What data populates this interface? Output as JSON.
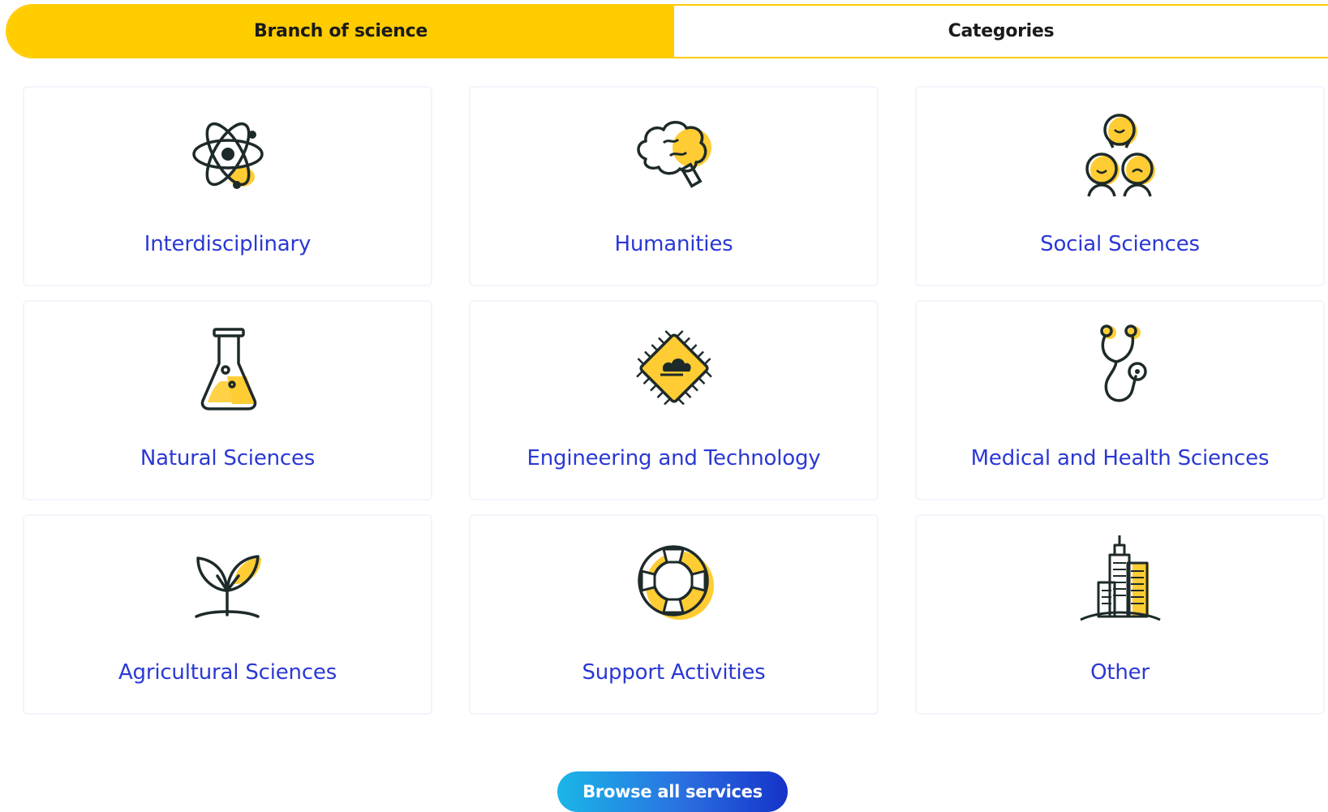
{
  "tabs": {
    "active_label": "Branch of science",
    "inactive_label": "Categories"
  },
  "categories": [
    {
      "label": "Interdisciplinary",
      "icon": "atom-icon"
    },
    {
      "label": "Humanities",
      "icon": "brain-icon"
    },
    {
      "label": "Social Sciences",
      "icon": "people-group-icon"
    },
    {
      "label": "Natural Sciences",
      "icon": "flask-icon"
    },
    {
      "label": "Engineering and Technology",
      "icon": "chip-icon"
    },
    {
      "label": "Medical and Health Sciences",
      "icon": "stethoscope-icon"
    },
    {
      "label": "Agricultural Sciences",
      "icon": "sprout-icon"
    },
    {
      "label": "Support Activities",
      "icon": "lifebuoy-icon"
    },
    {
      "label": "Other",
      "icon": "city-buildings-icon"
    }
  ],
  "browse_button": {
    "label": "Browse all services"
  },
  "colors": {
    "accent_yellow": "#ffcc00",
    "link_blue": "#2b38d4",
    "icon_dark": "#1e2a2a",
    "button_gradient_start": "#1ab6e8",
    "button_gradient_end": "#1533c9"
  }
}
